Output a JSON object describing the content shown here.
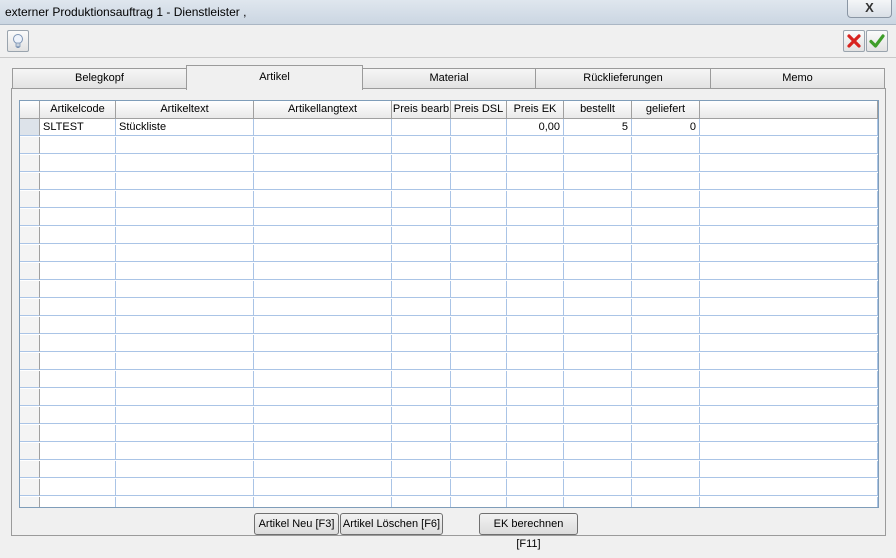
{
  "window": {
    "title": "externer Produktionsauftrag 1 - Dienstleister ,",
    "close_label": "X"
  },
  "toolbar": {
    "hint_icon": "lightbulb-icon",
    "cancel_icon": "red-x-icon",
    "ok_icon": "green-check-icon"
  },
  "tabs": [
    {
      "label": "Belegkopf",
      "active": false
    },
    {
      "label": "Artikel",
      "active": true
    },
    {
      "label": "Material",
      "active": false
    },
    {
      "label": "Rücklieferungen",
      "active": false
    },
    {
      "label": "Memo",
      "active": false
    }
  ],
  "grid": {
    "columns": [
      "",
      "Artikelcode",
      "Artikeltext",
      "Artikellangtext",
      "Preis bearb",
      "Preis DSL",
      "Preis EK",
      "bestellt",
      "geliefert",
      ""
    ],
    "rows": [
      [
        "",
        "SLTEST",
        "Stückliste",
        "",
        "",
        "",
        "0,00",
        "5",
        "0",
        ""
      ]
    ]
  },
  "buttons": {
    "new_label": "Artikel Neu [F3]",
    "delete_label": "Artikel Löschen [F6]",
    "calc_label": "EK berechnen [F11]"
  },
  "colors": {
    "grid_line": "#aac4e6",
    "grid_border": "#7f9db9",
    "window_bg": "#f0f0f0"
  }
}
